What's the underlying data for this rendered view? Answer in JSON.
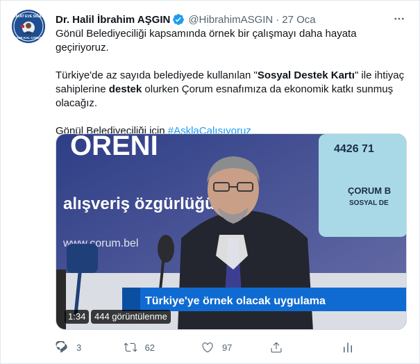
{
  "author": {
    "name": "Dr. Halil İbrahim AŞGIN",
    "handle": "@HibrahimASGIN",
    "separator": "·",
    "date": "27 Oca",
    "avatar_text_top": "HAYAT EVE SIĞAR",
    "avatar_text_bottom": "EVDE KAL ÇORUM"
  },
  "tweet": {
    "line1": "Gönül Belediyeciliği kapsamında örnek bir çalışmayı daha hayata geçiriyoruz.",
    "p2_a": "Türkiye'de az sayıda belediyede kullanılan \"",
    "p2_b": "Sosyal Destek Kartı",
    "p2_c": "\" ile ihtiyaç sahiplerine ",
    "p2_d": "destek",
    "p2_e": " olurken Çorum esnafımıza da ekonomik katkı sunmuş olacağız.",
    "p3_a": "Gönül Belediyeciliği için ",
    "p3_hashtag": "#AşklaÇalışıyoruz"
  },
  "video": {
    "duration": "1:34",
    "views": "444 görüntülenme",
    "banner_text": "Türkiye'ye örnek olacak uygulama",
    "bg_word": "ÖRENİ",
    "bg_slogan": "alışveriş özgürlüğü\"",
    "bg_url": "www.corum.bel",
    "card_number": "4426 71",
    "card_line1": "ÇORUM B",
    "card_line2": "SOSYAL DE"
  },
  "actions": {
    "replies": "3",
    "retweets": "62",
    "likes": "97"
  },
  "colors": {
    "accent": "#1d9bf0",
    "muted": "#536471",
    "text": "#0f1419"
  },
  "icons": [
    "verified-badge-icon",
    "more-icon",
    "reply-icon",
    "retweet-icon",
    "like-icon",
    "share-icon",
    "analytics-icon"
  ]
}
